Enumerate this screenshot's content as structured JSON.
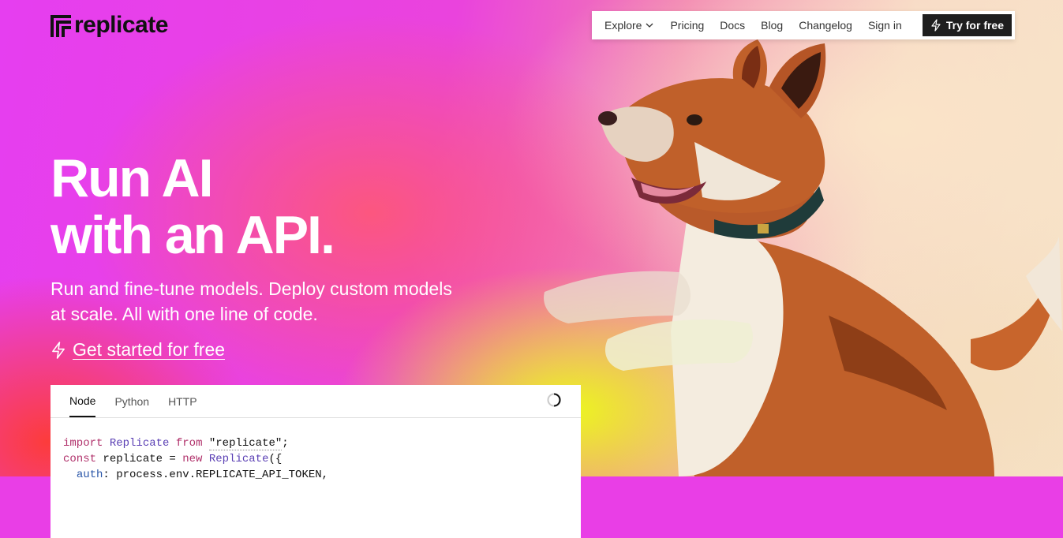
{
  "brand": {
    "name": "replicate"
  },
  "nav": {
    "items": [
      {
        "label": "Explore",
        "has_dropdown": true
      },
      {
        "label": "Pricing"
      },
      {
        "label": "Docs"
      },
      {
        "label": "Blog"
      },
      {
        "label": "Changelog"
      },
      {
        "label": "Sign in"
      }
    ],
    "cta_label": "Try for free"
  },
  "hero": {
    "title": "Run AI\nwith an API.",
    "subtitle": "Run and fine-tune models. Deploy custom models at scale. All with one line of code.",
    "cta_label": "Get started for free"
  },
  "code_panel": {
    "tabs": [
      {
        "label": "Node",
        "active": true
      },
      {
        "label": "Python",
        "active": false
      },
      {
        "label": "HTTP",
        "active": false
      }
    ],
    "lines": {
      "l1_kw1": "import",
      "l1_cls": "Replicate",
      "l1_kw2": "from",
      "l1_str": "\"replicate\"",
      "l1_end": ";",
      "l2_kw1": "const",
      "l2_mid": " replicate = ",
      "l2_kw2": "new",
      "l2_cls": "Replicate",
      "l2_end": "({",
      "l3_prop": "auth",
      "l3_rest": ": process.env.REPLICATE_API_TOKEN,"
    }
  },
  "colors": {
    "accent_dark": "#1e1e1e",
    "hero_magenta": "#e93ee6",
    "hero_yellow": "#ecff14"
  },
  "icons": [
    "replicate-logo-icon",
    "chevron-down-icon",
    "lightning-icon",
    "spinner-icon",
    "dog-illustration"
  ]
}
